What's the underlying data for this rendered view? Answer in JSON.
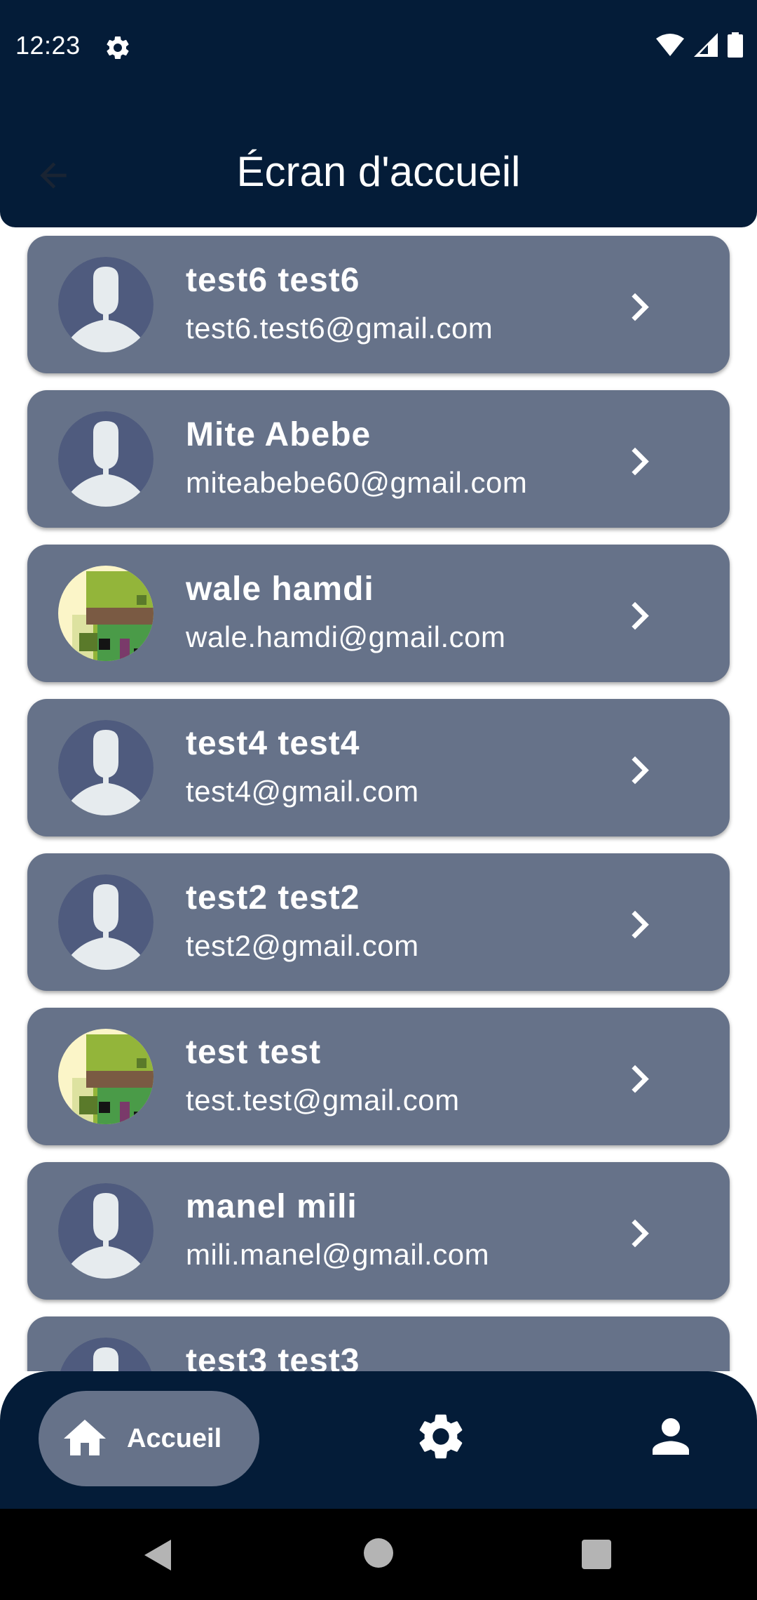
{
  "status_bar": {
    "time": "12:23",
    "icons": [
      "gear-icon",
      "wifi-icon",
      "signal-icon",
      "battery-icon"
    ]
  },
  "app_bar": {
    "title": "Écran d'accueil",
    "back_icon": "arrow-left-icon"
  },
  "users": [
    {
      "name": "test6 test6",
      "email": "test6.test6@gmail.com",
      "avatar": "default"
    },
    {
      "name": "Mite Abebe",
      "email": "miteabebe60@gmail.com",
      "avatar": "default"
    },
    {
      "name": "wale hamdi",
      "email": "wale.hamdi@gmail.com",
      "avatar": "pixel"
    },
    {
      "name": "test4 test4",
      "email": "test4@gmail.com",
      "avatar": "default"
    },
    {
      "name": "test2 test2",
      "email": "test2@gmail.com",
      "avatar": "default"
    },
    {
      "name": "test test",
      "email": "test.test@gmail.com",
      "avatar": "pixel"
    },
    {
      "name": "manel mili",
      "email": "mili.manel@gmail.com",
      "avatar": "default"
    },
    {
      "name": "test3 test3",
      "email": "",
      "avatar": "default"
    }
  ],
  "bottom_nav": {
    "items": [
      {
        "label": "Accueil",
        "icon": "home-icon",
        "active": true
      },
      {
        "label": "",
        "icon": "settings-icon",
        "active": false
      },
      {
        "label": "",
        "icon": "profile-icon",
        "active": false
      }
    ]
  },
  "colors": {
    "primary_dark": "#041c38",
    "card": "#667289",
    "avatar_bg": "#4f5b7e",
    "avatar_figure": "#e6ebee"
  }
}
